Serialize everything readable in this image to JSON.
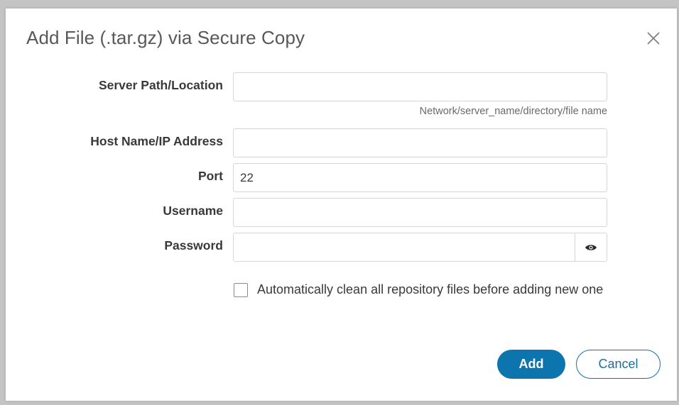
{
  "dialog": {
    "title": "Add File (.tar.gz) via Secure Copy",
    "close_icon": "close-icon"
  },
  "form": {
    "server_path": {
      "label": "Server Path/Location",
      "value": "",
      "hint": "Network/server_name/directory/file name"
    },
    "host": {
      "label": "Host Name/IP Address",
      "value": ""
    },
    "port": {
      "label": "Port",
      "value": "22"
    },
    "username": {
      "label": "Username",
      "value": ""
    },
    "password": {
      "label": "Password",
      "value": "",
      "toggle_icon": "eye-icon"
    },
    "auto_clean": {
      "label": "Automatically clean all repository files before adding new one",
      "checked": false
    }
  },
  "actions": {
    "add_label": "Add",
    "cancel_label": "Cancel"
  },
  "colors": {
    "primary": "#0d75ad",
    "title": "#58585b",
    "label": "#39393b",
    "border": "#d6d6d6"
  }
}
